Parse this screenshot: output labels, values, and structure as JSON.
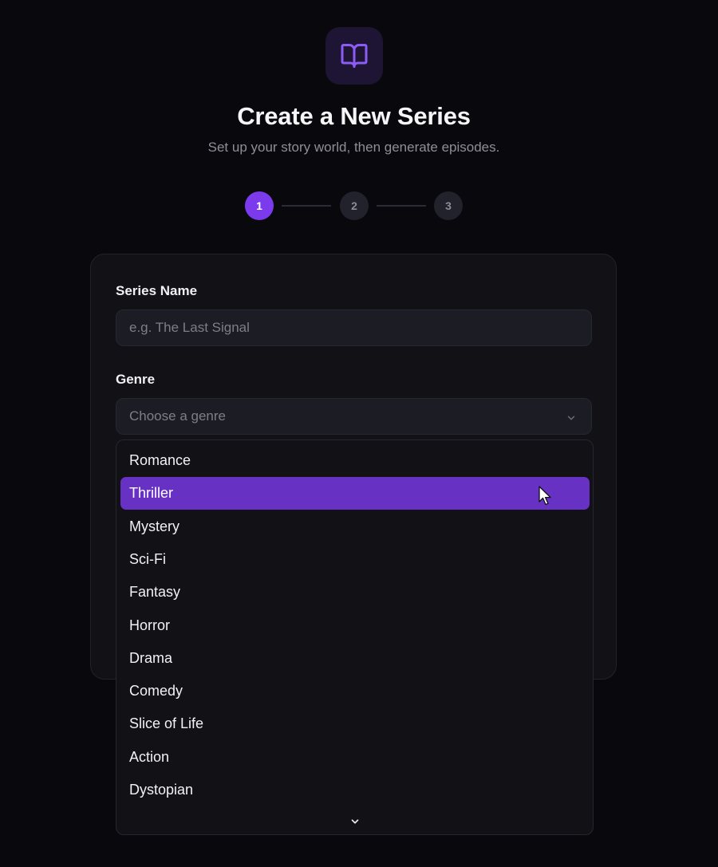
{
  "header": {
    "icon": "open-book-icon",
    "title": "Create a New Series",
    "subtitle": "Set up your story world, then generate episodes."
  },
  "stepper": {
    "current_step": 1,
    "steps": [
      "1",
      "2",
      "3"
    ]
  },
  "form": {
    "series_name": {
      "label": "Series Name",
      "value": "",
      "placeholder": "e.g. The Last Signal"
    },
    "genre": {
      "label": "Genre",
      "placeholder": "Choose a genre",
      "is_open": true,
      "highlighted": "Thriller",
      "options": [
        "Romance",
        "Thriller",
        "Mystery",
        "Sci-Fi",
        "Fantasy",
        "Horror",
        "Drama",
        "Comedy",
        "Slice of Life",
        "Action",
        "Dystopian"
      ]
    }
  },
  "colors": {
    "accent": "#7c3aed",
    "highlight": "#6731c4",
    "background": "#09090d",
    "card": "#111116"
  }
}
